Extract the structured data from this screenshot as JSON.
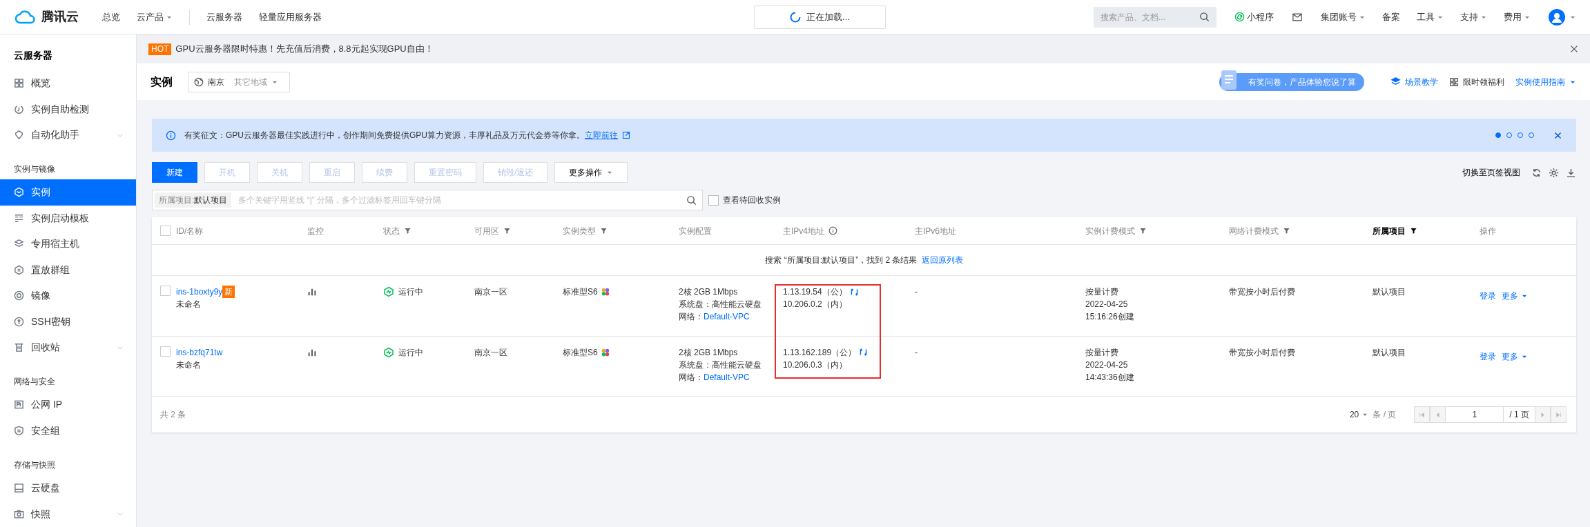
{
  "top_nav": {
    "logo": "腾讯云",
    "links": [
      {
        "label": "总览",
        "kind": "link"
      },
      {
        "label": "云产品",
        "kind": "menu"
      },
      {
        "kind": "divider"
      },
      {
        "label": "云服务器",
        "kind": "link"
      },
      {
        "label": "轻量应用服务器",
        "kind": "link"
      }
    ],
    "loading": "正在加载...",
    "search_placeholder": "搜索产品、文档...",
    "items": [
      {
        "label": "小程序",
        "kind": "app"
      },
      {
        "kind": "mail"
      },
      {
        "label": "集团账号",
        "kind": "menu"
      },
      {
        "label": "备案",
        "kind": "link"
      },
      {
        "label": "工具",
        "kind": "menu"
      },
      {
        "label": "支持",
        "kind": "menu"
      },
      {
        "label": "费用",
        "kind": "menu"
      },
      {
        "kind": "avatar"
      }
    ]
  },
  "sidebar": {
    "title": "云服务器",
    "groups": [
      {
        "items": [
          {
            "label": "概览",
            "kind": "link",
            "selected": false
          },
          {
            "label": "实例自助检测",
            "kind": "link",
            "selected": false
          },
          {
            "label": "自动化助手",
            "kind": "folder",
            "selected": false
          }
        ]
      },
      {
        "label": "实例与镜像",
        "items": [
          {
            "label": "实例",
            "kind": "link",
            "selected": true
          },
          {
            "label": "实例启动模板",
            "kind": "link",
            "selected": false
          },
          {
            "label": "专用宿主机",
            "kind": "link",
            "selected": false
          },
          {
            "label": "置放群组",
            "kind": "link",
            "selected": false
          },
          {
            "label": "镜像",
            "kind": "link",
            "selected": false
          },
          {
            "label": "SSH密钥",
            "kind": "link",
            "selected": false
          },
          {
            "label": "回收站",
            "kind": "folder",
            "selected": false
          }
        ]
      },
      {
        "label": "网络与安全",
        "items": [
          {
            "label": "公网 IP",
            "kind": "link",
            "selected": false
          },
          {
            "label": "安全组",
            "kind": "link",
            "selected": false
          }
        ]
      },
      {
        "label": "存储与快照",
        "items": [
          {
            "label": "云硬盘",
            "kind": "link",
            "selected": false
          },
          {
            "label": "快照",
            "kind": "folder",
            "selected": false
          }
        ]
      }
    ]
  },
  "promo": {
    "badge": "HOT",
    "text": "GPU云服务器限时特惠！先充值后消费，8.8元起实现GPU自由！"
  },
  "page_header": {
    "title": "实例",
    "region": "南京",
    "other_regions": "其它地域",
    "survey": "有奖问卷，产品体验您说了算",
    "links": [
      {
        "label": "场景教学",
        "kind": "tutorial"
      },
      {
        "label": "限时领福利",
        "kind": "gift"
      },
      {
        "label": "实例使用指南",
        "kind": "guide"
      }
    ]
  },
  "notice": {
    "text": "有奖征文：GPU云服务器最佳实践进行中，创作期间免费提供GPU算力资源，丰厚礼品及万元代金券等你拿。",
    "link": "立即前往",
    "dots": [
      {
        "selected": true
      },
      {
        "selected": false
      },
      {
        "selected": false
      },
      {
        "selected": false
      }
    ]
  },
  "toolbar": {
    "buttons": [
      {
        "label": "新建",
        "kind": "primary",
        "disabled": false
      },
      {
        "label": "开机",
        "kind": "default",
        "disabled": true
      },
      {
        "label": "关机",
        "kind": "default",
        "disabled": true
      },
      {
        "label": "重启",
        "kind": "default",
        "disabled": true
      },
      {
        "label": "续费",
        "kind": "default",
        "disabled": true
      },
      {
        "label": "重置密码",
        "kind": "default",
        "disabled": true
      },
      {
        "label": "销毁/退还",
        "kind": "default",
        "disabled": true
      },
      {
        "label": "更多操作",
        "kind": "menu",
        "disabled": false
      }
    ],
    "switch_view": "切换至页签视图"
  },
  "search": {
    "tag_key": "所属项目:",
    "tag_value": "默认项目",
    "placeholder": "多个关键字用竖线 “|” 分隔，多个过滤标签用回车键分隔",
    "recycle": {
      "label": "查看待回收实例",
      "checked": false
    }
  },
  "table": {
    "header_checked": false,
    "columns": [
      {
        "label": "ID/名称",
        "filter": false,
        "info": false,
        "active": false,
        "highlighted": false
      },
      {
        "label": "监控",
        "filter": false,
        "info": false,
        "active": false,
        "highlighted": false
      },
      {
        "label": "状态",
        "filter": true,
        "info": false,
        "active": false,
        "highlighted": false
      },
      {
        "label": "可用区",
        "filter": true,
        "info": false,
        "active": false,
        "highlighted": false
      },
      {
        "label": "实例类型",
        "filter": true,
        "info": false,
        "active": false,
        "highlighted": false
      },
      {
        "label": "实例配置",
        "filter": false,
        "info": false,
        "active": false,
        "highlighted": false
      },
      {
        "label": "主IPv4地址",
        "filter": false,
        "info": true,
        "active": false,
        "highlighted": true
      },
      {
        "label": "主IPv6地址",
        "filter": false,
        "info": false,
        "active": false,
        "highlighted": false
      },
      {
        "label": "实例计费模式",
        "filter": true,
        "info": false,
        "active": false,
        "highlighted": false
      },
      {
        "label": "网络计费模式",
        "filter": true,
        "info": false,
        "active": false,
        "highlighted": false
      },
      {
        "label": "所属项目",
        "filter": true,
        "info": false,
        "active": true,
        "highlighted": false
      },
      {
        "label": "操作",
        "filter": false,
        "info": false,
        "active": false,
        "highlighted": false
      }
    ],
    "result_notice": {
      "text": "搜索 “所属项目:默认项目”，找到 2 条结果",
      "link": "返回原列表"
    },
    "rows": [
      {
        "checked": false,
        "id": "ins-1boxty9y",
        "new_badge": "新",
        "name": "未命名",
        "status": "运行中",
        "zone": "南京一区",
        "type": "标准型S6",
        "config": {
          "spec": "2核 2GB 1Mbps",
          "disk": "系统盘：高性能云硬盘",
          "network_label": "网络：",
          "network": "Default-VPC"
        },
        "ipv4": [
          "1.13.19.54（公）",
          "10.206.0.2（内）"
        ],
        "ipv6": "-",
        "billing": [
          "按量计费",
          "2022-04-25",
          "15:16:26创建"
        ],
        "net_billing": "带宽按小时后付费",
        "project": "默认项目",
        "actions": [
          {
            "label": "登录",
            "kind": "link"
          },
          {
            "label": "更多",
            "kind": "menu"
          }
        ]
      },
      {
        "checked": false,
        "id": "ins-bzfq71tw",
        "name": "未命名",
        "status": "运行中",
        "zone": "南京一区",
        "type": "标准型S6",
        "config": {
          "spec": "2核 2GB 1Mbps",
          "disk": "系统盘：高性能云硬盘",
          "network_label": "网络：",
          "network": "Default-VPC"
        },
        "ipv4": [
          "1.13.162.189（公）",
          "10.206.0.3（内）"
        ],
        "ipv6": "-",
        "billing": [
          "按量计费",
          "2022-04-25",
          "14:43:36创建"
        ],
        "net_billing": "带宽按小时后付费",
        "project": "默认项目",
        "actions": [
          {
            "label": "登录",
            "kind": "link"
          },
          {
            "label": "更多",
            "kind": "menu"
          }
        ]
      }
    ],
    "footer": {
      "total": "共 2 条",
      "page_size": "20",
      "per_page": "条 / 页",
      "page": "1",
      "pages": "/ 1 页"
    }
  }
}
